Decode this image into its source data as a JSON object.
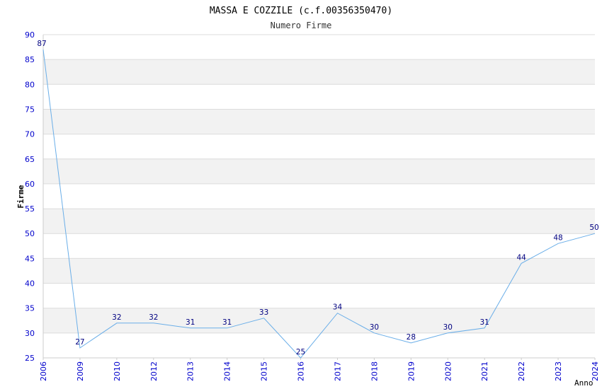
{
  "chart_data": {
    "type": "line",
    "title": "MASSA E COZZILE (c.f.00356350470)",
    "subtitle": "Numero Firme",
    "xlabel": "Anno",
    "ylabel": "Firme",
    "categories": [
      "2006",
      "2009",
      "2010",
      "2012",
      "2013",
      "2014",
      "2015",
      "2016",
      "2017",
      "2018",
      "2019",
      "2020",
      "2021",
      "2022",
      "2023",
      "2024"
    ],
    "values": [
      87,
      27,
      32,
      32,
      31,
      31,
      33,
      25,
      34,
      30,
      28,
      30,
      31,
      44,
      48,
      50
    ],
    "y_ticks": [
      "25",
      "30",
      "35",
      "40",
      "45",
      "50",
      "55",
      "60",
      "65",
      "70",
      "75",
      "80",
      "85",
      "90"
    ],
    "ylim": [
      25,
      90
    ],
    "grid": "horizontal alternating bands",
    "legend": "none",
    "colors": {
      "line": "#6aaee8",
      "band": "#f2f2f2",
      "gridline": "#dcdcdc",
      "axis": "#cccccc",
      "tick_text": "#0000cc",
      "data_label": "#000080"
    }
  }
}
